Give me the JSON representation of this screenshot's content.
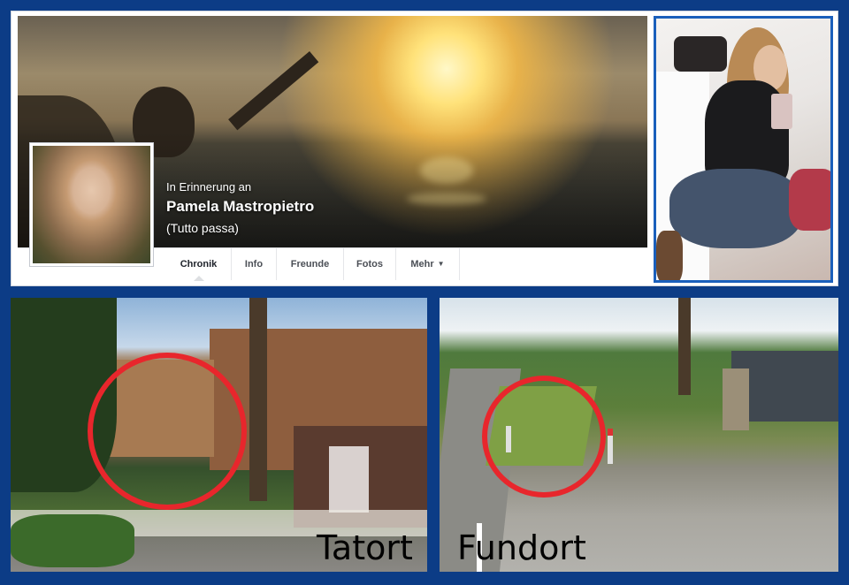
{
  "profile": {
    "memorial_label": "In Erinnerung an",
    "name": "Pamela Mastropietro",
    "tagline": "(Tutto passa)"
  },
  "tabs": [
    {
      "label": "Chronik",
      "active": true
    },
    {
      "label": "Info",
      "active": false
    },
    {
      "label": "Freunde",
      "active": false
    },
    {
      "label": "Fotos",
      "active": false
    },
    {
      "label": "Mehr",
      "active": false
    }
  ],
  "more_tab_icon": "chevron-down-icon",
  "scenes": {
    "left_label": "Tatort",
    "right_label": "Fundort"
  },
  "colors": {
    "frame": "#0c3c86",
    "photo_border": "#1a5fbb",
    "marker_circle": "#e8262c"
  }
}
